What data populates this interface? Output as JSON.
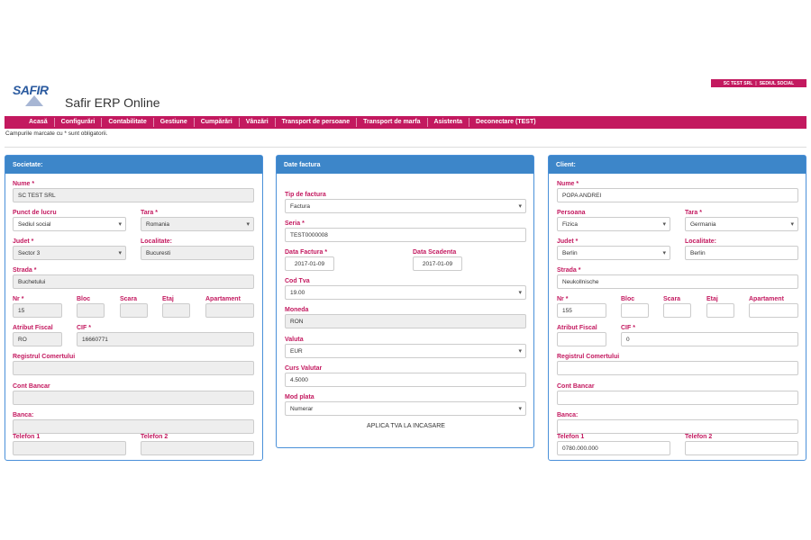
{
  "header": {
    "badge_company": "SC TEST SRL",
    "badge_location": "SEDIUL SOCIAL",
    "logo_text": "SAFIR",
    "app_title": "Safir ERP Online"
  },
  "nav": {
    "items": [
      "Acasă",
      "Configurări",
      "Contabilitate",
      "Gestiune",
      "Cumpărări",
      "Vânzări",
      "Transport de persoane",
      "Transport de marfa",
      "Asistenta",
      "Deconectare (TEST)"
    ]
  },
  "required_note": "Campurile marcate cu * sunt obligatorii.",
  "societate": {
    "title": "Societate:",
    "nume_label": "Nume *",
    "nume_value": "SC TEST SRL",
    "punct_label": "Punct de lucru",
    "punct_value": "Sediul social",
    "tara_label": "Tara *",
    "tara_value": "Romania",
    "judet_label": "Judet *",
    "judet_value": "Sector 3",
    "localitate_label": "Localitate:",
    "localitate_value": "Bucuresti",
    "strada_label": "Strada *",
    "strada_value": "Buchetului",
    "nr_label": "Nr *",
    "nr_value": "15",
    "bloc_label": "Bloc",
    "bloc_value": "",
    "scara_label": "Scara",
    "scara_value": "",
    "etaj_label": "Etaj",
    "etaj_value": "",
    "apartament_label": "Apartament",
    "apartament_value": "",
    "atribut_label": "Atribut Fiscal",
    "atribut_value": "RO",
    "cif_label": "CIF *",
    "cif_value": "16660771",
    "registrul_label": "Registrul Comertului",
    "registrul_value": "",
    "cont_label": "Cont Bancar",
    "cont_value": "",
    "banca_label": "Banca:",
    "banca_value": "",
    "tel1_label": "Telefon 1",
    "tel1_value": "",
    "tel2_label": "Telefon 2",
    "tel2_value": ""
  },
  "factura": {
    "title": "Date factura",
    "tip_label": "Tip de factura",
    "tip_value": "Factura",
    "seria_label": "Seria *",
    "seria_value": "TEST0000008",
    "data_label": "Data Factura *",
    "data_value": "2017-01-09",
    "scadenta_label": "Data Scadenta",
    "scadenta_value": "2017-01-09",
    "cod_label": "Cod Tva",
    "cod_value": "19.00",
    "moneda_label": "Moneda",
    "moneda_value": "RON",
    "valuta_label": "Valuta",
    "valuta_value": "EUR",
    "curs_label": "Curs Valutar",
    "curs_value": "4.5000",
    "mod_label": "Mod plata",
    "mod_value": "Numerar",
    "aplica_text": "APLICA TVA LA INCASARE"
  },
  "client": {
    "title": "Client:",
    "nume_label": "Nume *",
    "nume_value": "POPA ANDREI",
    "persoana_label": "Persoana",
    "persoana_value": "Fizica",
    "tara_label": "Tara *",
    "tara_value": "Germania",
    "judet_label": "Judet *",
    "judet_value": "Berlin",
    "localitate_label": "Localitate:",
    "localitate_value": "Berlin",
    "strada_label": "Strada *",
    "strada_value": "Neukollnische",
    "nr_label": "Nr *",
    "nr_value": "155",
    "bloc_label": "Bloc",
    "bloc_value": "",
    "scara_label": "Scara",
    "scara_value": "",
    "etaj_label": "Etaj",
    "etaj_value": "",
    "apartament_label": "Apartament",
    "apartament_value": "",
    "atribut_label": "Atribut Fiscal",
    "atribut_value": "",
    "cif_label": "CIF *",
    "cif_value": "0",
    "registrul_label": "Registrul Comertului",
    "registrul_value": "",
    "cont_label": "Cont Bancar",
    "cont_value": "",
    "banca_label": "Banca:",
    "banca_value": "",
    "tel1_label": "Telefon 1",
    "tel1_value": "0780.000.000",
    "tel2_label": "Telefon 2",
    "tel2_value": ""
  }
}
